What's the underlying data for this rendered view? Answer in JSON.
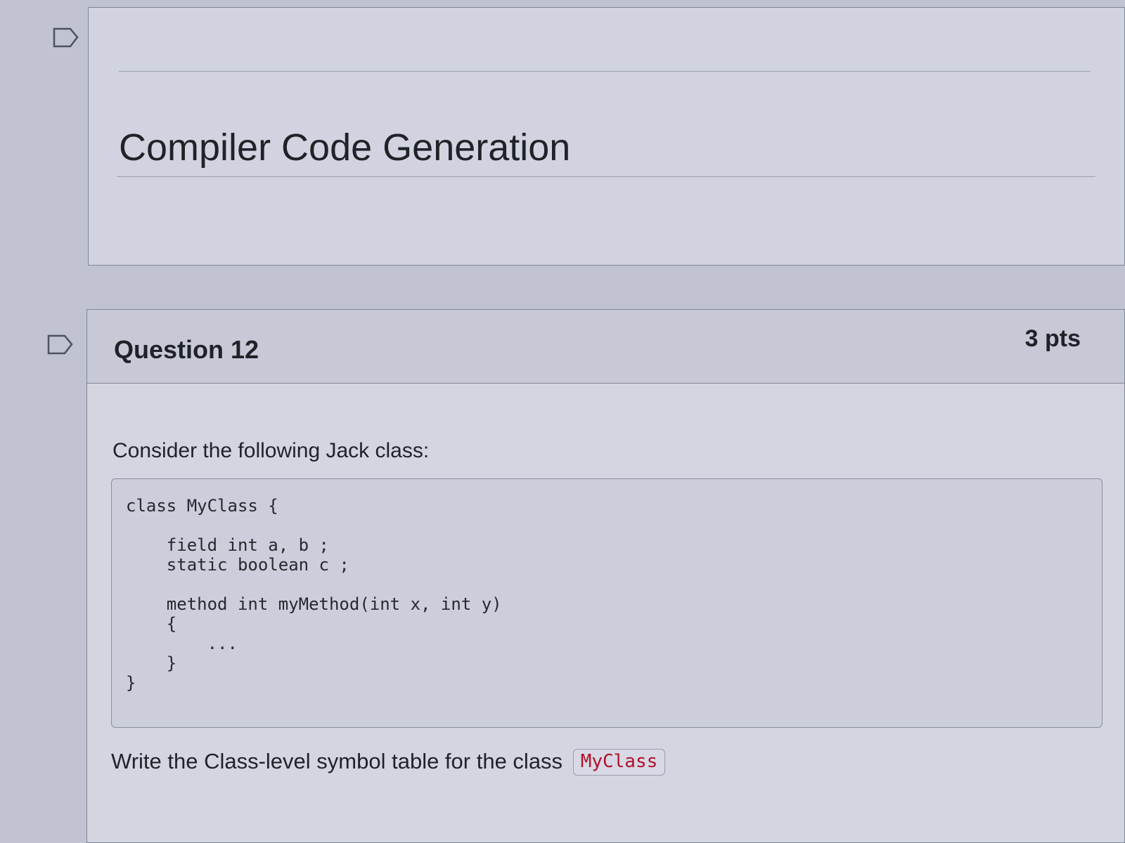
{
  "section": {
    "title": "Compiler Code Generation"
  },
  "question": {
    "title": "Question 12",
    "points": "3 pts",
    "prompt": "Consider the following Jack class:",
    "code": "class MyClass {\n\n    field int a, b ;\n    static boolean c ;\n\n    method int myMethod(int x, int y)\n    {\n        ...\n    }\n}",
    "instruction": "Write the Class-level symbol table for the class",
    "class_name": "MyClass"
  },
  "icons": {
    "section_flag": "flag-outline-icon",
    "question_flag": "flag-outline-icon"
  },
  "colors": {
    "code_inline": "#b0112b"
  }
}
